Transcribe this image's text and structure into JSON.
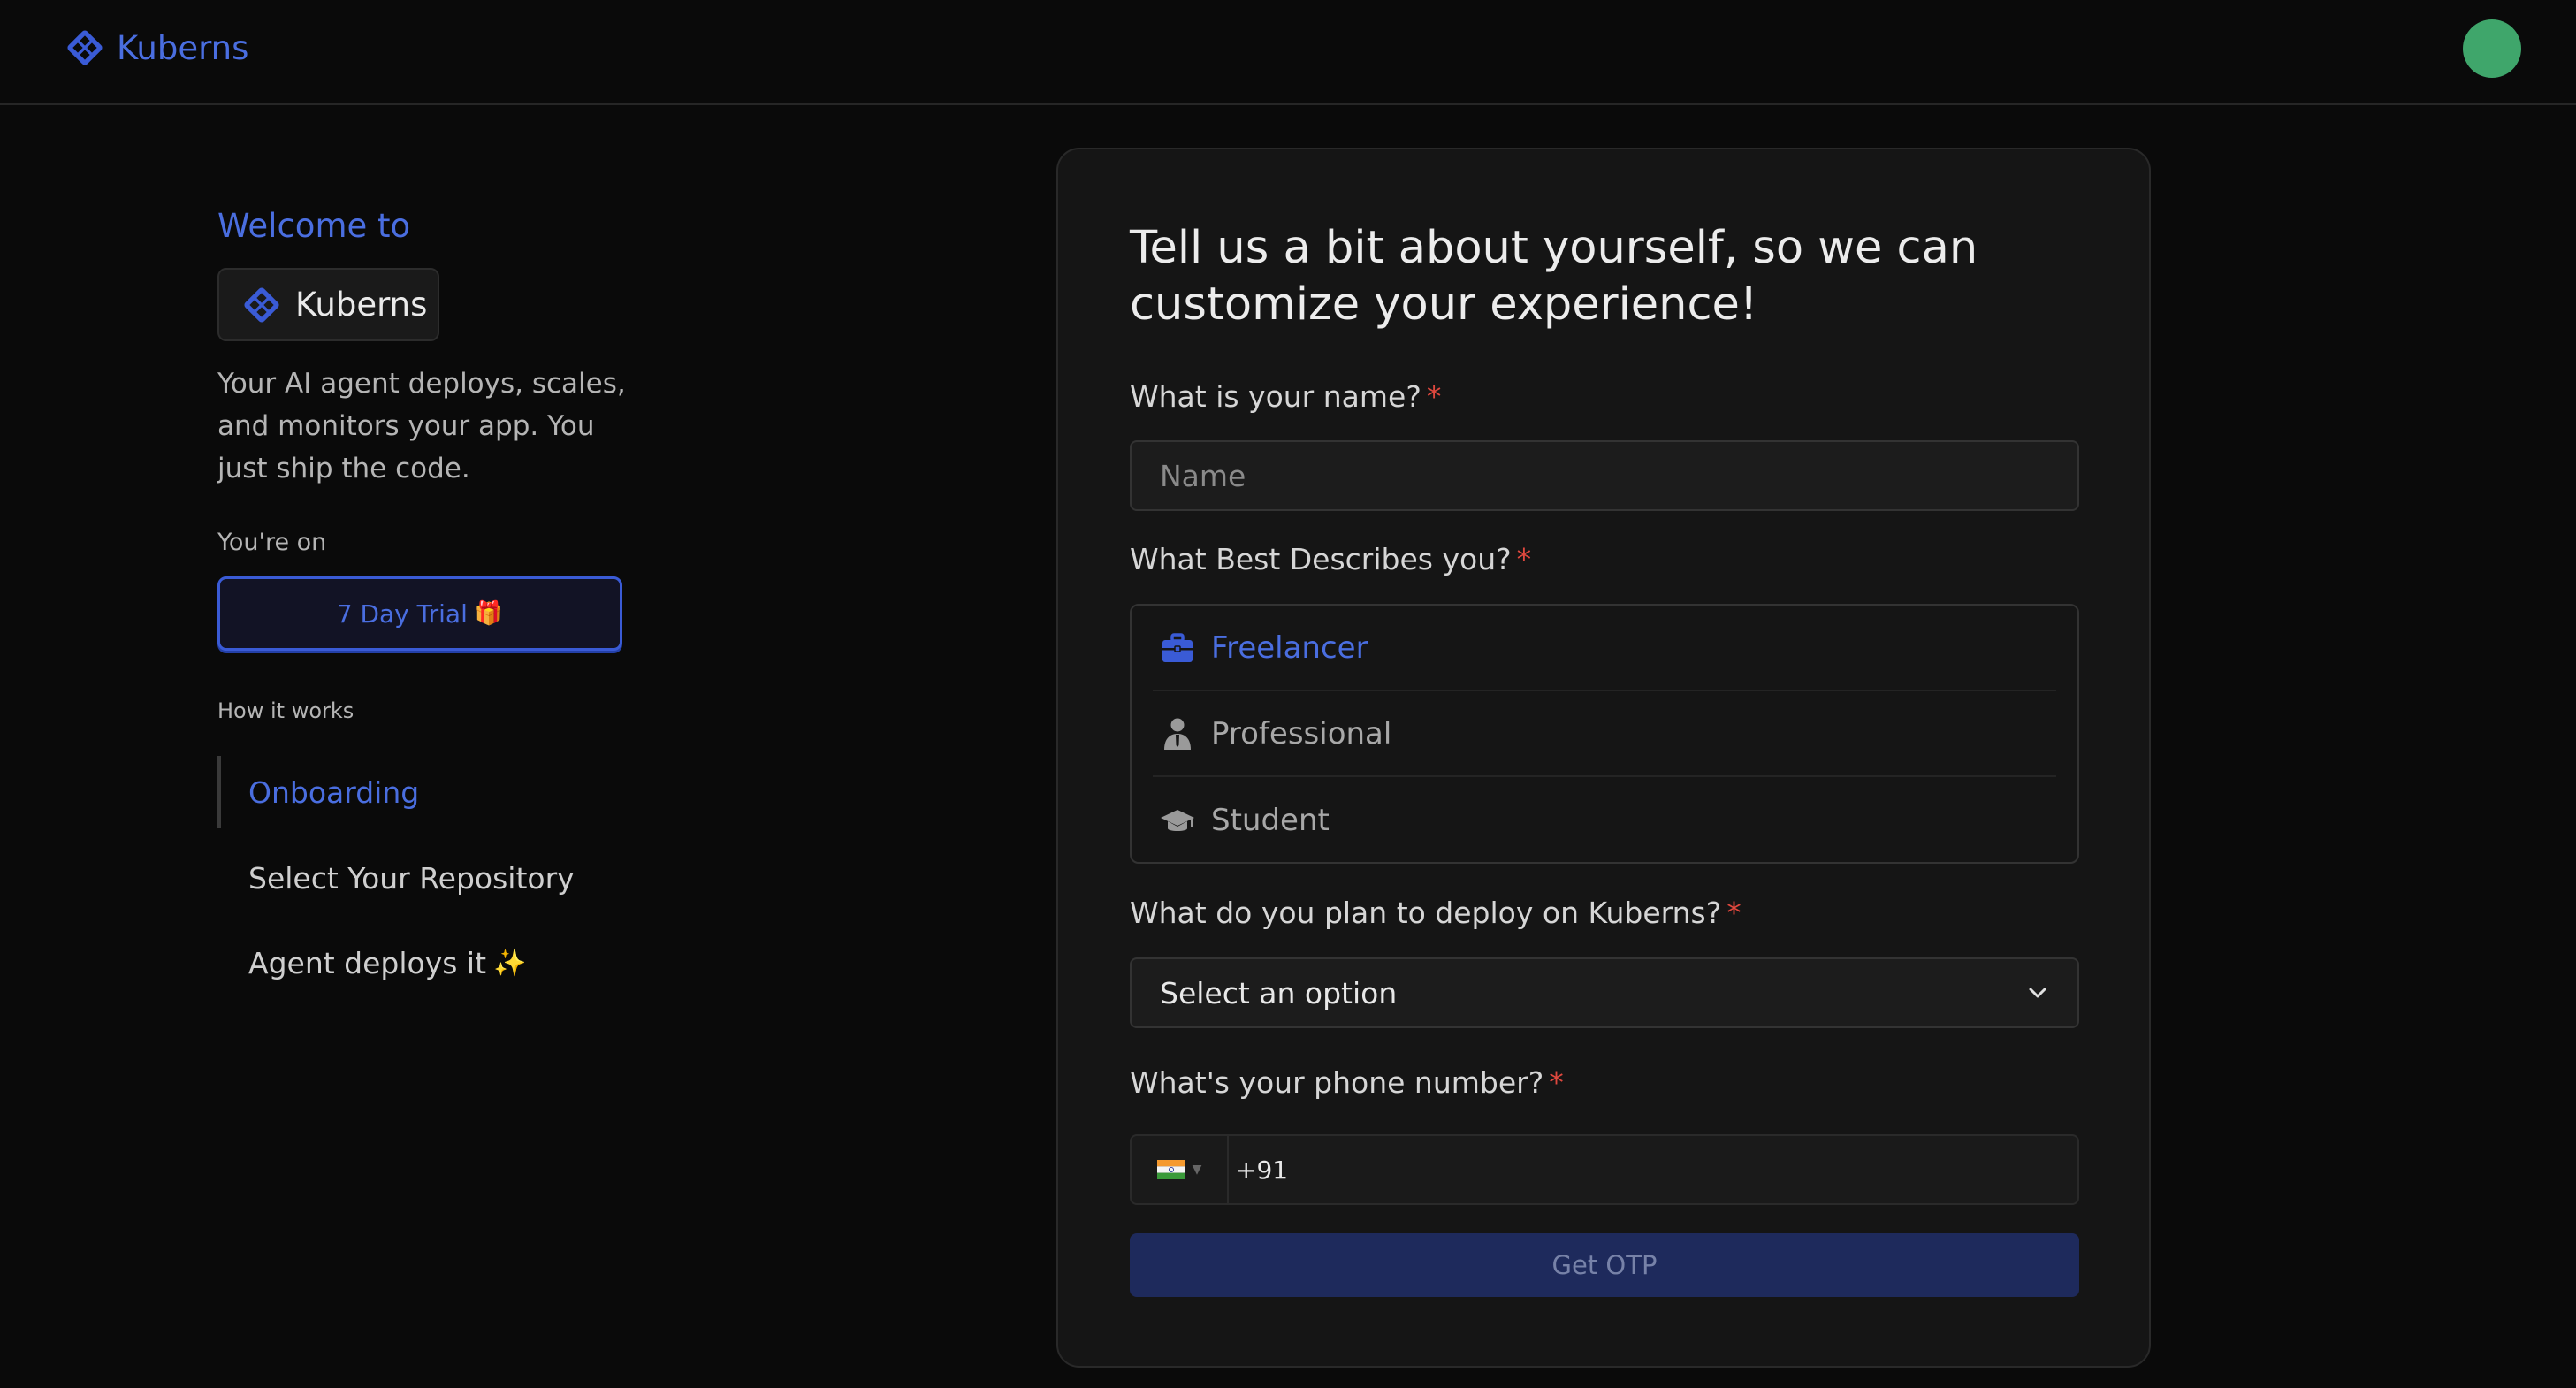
{
  "header": {
    "brand": "Kuberns"
  },
  "intro": {
    "welcome": "Welcome to",
    "brand": "Kuberns",
    "tagline": "Your AI agent deploys, scales, and monitors your app. You just ship the code.",
    "plan_label": "You're on",
    "trial_label": "7 Day Trial",
    "trial_icon": "🎁",
    "how_label": "How it works",
    "steps": [
      {
        "label": "Onboarding",
        "active": true
      },
      {
        "label": "Select Your Repository",
        "active": false
      },
      {
        "label": "Agent deploys it",
        "suffix": "✨",
        "active": false
      }
    ]
  },
  "form": {
    "title": "Tell us a bit about yourself, so we can customize your experience!",
    "name": {
      "label": "What is your name?",
      "required_mark": "*",
      "placeholder": "Name",
      "value": ""
    },
    "role": {
      "label": "What Best Describes you?",
      "required_mark": "*",
      "options": [
        {
          "label": "Freelancer",
          "icon": "briefcase-icon",
          "selected": true
        },
        {
          "label": "Professional",
          "icon": "person-icon",
          "selected": false
        },
        {
          "label": "Student",
          "icon": "graduation-cap-icon",
          "selected": false
        }
      ]
    },
    "deploy": {
      "label": "What do you plan to deploy on Kuberns?",
      "required_mark": "*",
      "selected": "Select an option"
    },
    "phone": {
      "label": "What's your phone number?",
      "required_mark": "*",
      "country": "India",
      "value": "+91"
    },
    "submit_label": "Get OTP"
  },
  "colors": {
    "accent": "#4a6ee0",
    "background": "#0a0a0a",
    "card": "#151515",
    "required": "#e0483e",
    "avatar": "#3fa66b",
    "button_disabled": "#1e2a5c"
  }
}
